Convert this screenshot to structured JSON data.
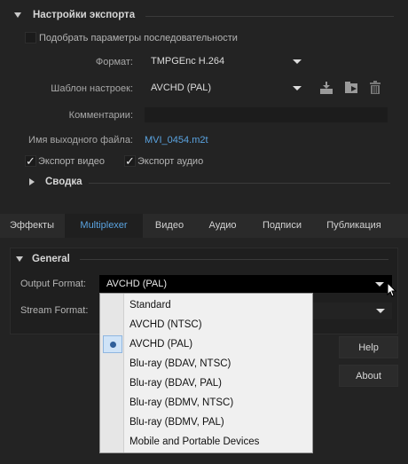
{
  "export_settings": {
    "title": "Настройки экспорта",
    "match_sequence_label": "Подобрать параметры последовательности",
    "format_label": "Формат:",
    "format_value": "TMPGEnc H.264",
    "preset_label": "Шаблон настроек:",
    "preset_value": "AVCHD (PAL)",
    "comments_label": "Комментарии:",
    "comments_value": "",
    "output_name_label": "Имя выходного файла:",
    "output_name_value": "MVI_0454.m2t",
    "export_video_label": "Экспорт видео",
    "export_audio_label": "Экспорт аудио",
    "summary_label": "Сводка"
  },
  "tabs": [
    {
      "label": "Эффекты"
    },
    {
      "label": "Multiplexer"
    },
    {
      "label": "Видео"
    },
    {
      "label": "Аудио"
    },
    {
      "label": "Подписи"
    },
    {
      "label": "Публикация"
    }
  ],
  "general": {
    "title": "General",
    "output_format_label": "Output Format:",
    "output_format_value": "AVCHD (PAL)",
    "stream_format_label": "Stream Format:"
  },
  "buttons": {
    "help": "Help",
    "about": "About"
  },
  "dropdown": {
    "options": [
      "Standard",
      "AVCHD (NTSC)",
      "AVCHD (PAL)",
      "Blu-ray (BDAV, NTSC)",
      "Blu-ray (BDAV, PAL)",
      "Blu-ray (BDMV, NTSC)",
      "Blu-ray (BDMV, PAL)",
      "Mobile and Portable Devices"
    ],
    "selected": "AVCHD (PAL)"
  },
  "colors": {
    "accent": "#5aa3e0",
    "panel": "#232323"
  }
}
